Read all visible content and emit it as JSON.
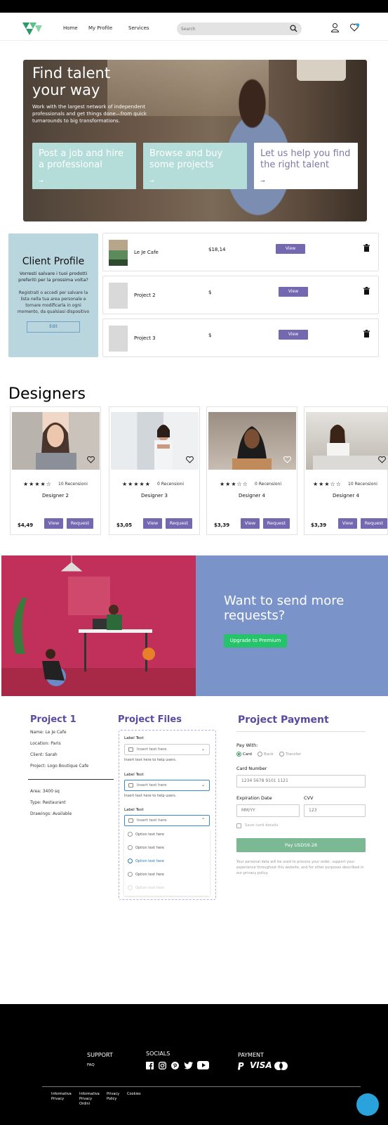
{
  "header": {
    "nav": [
      "Home",
      "My Profile",
      "Services"
    ],
    "search_placeholder": "Search"
  },
  "hero": {
    "title": "Find talent your way",
    "subtitle": "Work with the largest network of independent professionals and get things done—from quick turnarounds to big transformations.",
    "cards": [
      {
        "title": "Post a job and hire a professional",
        "arrow": "→"
      },
      {
        "title": "Browse and buy some projects",
        "arrow": "→"
      },
      {
        "title": "Let us help you find the right talent",
        "arrow": "→"
      }
    ]
  },
  "client_profile": {
    "title": "Client Profile",
    "prompt": "Vorresti salvare i tuoi prodotti preferiti per la prossima volta?",
    "body": "Registrati o accedi per salvare la lista nella tua area personale e tornare modificarla in ogni momento, da qualsiasi dispositivo",
    "button": "Edit"
  },
  "projects": [
    {
      "name": "Le Je Cafe",
      "price": "$18,14",
      "view": "View"
    },
    {
      "name": "Project 2",
      "price": "$",
      "view": "View"
    },
    {
      "name": "Project 3",
      "price": "$",
      "view": "View"
    }
  ],
  "designers_section": {
    "title": "Designers",
    "cards": [
      {
        "stars": "★★★★☆",
        "reviews": "10 Recensioni",
        "name": "Designer 2",
        "price": "$4,49",
        "view": "View",
        "request": "Request"
      },
      {
        "stars": "★★★★★",
        "reviews": "0 Recensioni",
        "name": "Designer 3",
        "price": "$3,05",
        "view": "View",
        "request": "Request"
      },
      {
        "stars": "★★★☆☆",
        "reviews": "0 Recensioni",
        "name": "Designer 4",
        "price": "$3,39",
        "view": "View",
        "request": "Request"
      },
      {
        "stars": "★★★☆☆",
        "reviews": "10 Recensioni",
        "name": "Designer 4",
        "price": "$3,39",
        "view": "View",
        "request": "Request"
      }
    ]
  },
  "promo": {
    "title": "Want to send more requests?",
    "button": "Upgrade to Premium"
  },
  "project1": {
    "title": "Project 1",
    "items": [
      "Name: Le Je Cafe",
      "Location: Paris",
      "Client: Sarah",
      "Project: Logo Boutique Cafe"
    ],
    "items2": [
      "Area: 3400 sq",
      "Type: Restaurant",
      "Drawings: Available"
    ]
  },
  "project_files": {
    "title": "Project Files",
    "fields": [
      {
        "label": "Label Text",
        "placeholder": "Insert text here",
        "help": "Insert text here to help users."
      },
      {
        "label": "Label Text",
        "placeholder": "Insert text here",
        "help": "Insert text here to help users."
      },
      {
        "label": "Label Text",
        "placeholder": "Insert text here"
      }
    ],
    "options": [
      "Option text here",
      "Option text here",
      "Option text here",
      "Option text here",
      "Option text here"
    ]
  },
  "payment": {
    "title": "Project Payment",
    "pay_with": "Pay With:",
    "methods": [
      "Card",
      "Bank",
      "Transfer"
    ],
    "card_number_label": "Card Number",
    "card_number_placeholder": "1234 5678 9101 1121",
    "exp_label": "Expiration Date",
    "exp_placeholder": "MM/YY",
    "cvv_label": "CVV",
    "cvv_placeholder": "123",
    "save_label": "Save card details",
    "pay_button": "Pay USD59.28",
    "note": "Your personal data will be used to process your order, support your experience throughout this website, and for other purposes described in our privacy policy."
  },
  "footer": {
    "support_title": "SUPPORT",
    "support_link": "FAQ",
    "socials_title": "SOCIALS",
    "payment_title": "PAYMENT",
    "payment_visa": "VISA",
    "links": [
      "Informativa Privacy",
      "Informativa Privacy Ordini",
      "Privacy Policy",
      "Cookies"
    ]
  },
  "colors": {
    "purple": "#7468b0",
    "heading_purple": "#5a4aa0",
    "teal_card": "#b4dcd8",
    "client_bg": "#b9d6df",
    "promo_red": "#c0305a",
    "promo_blue": "#7a93c8",
    "premium_green": "#26c46a",
    "pay_green": "#7bb894",
    "chat_blue": "#2aa3dc"
  }
}
